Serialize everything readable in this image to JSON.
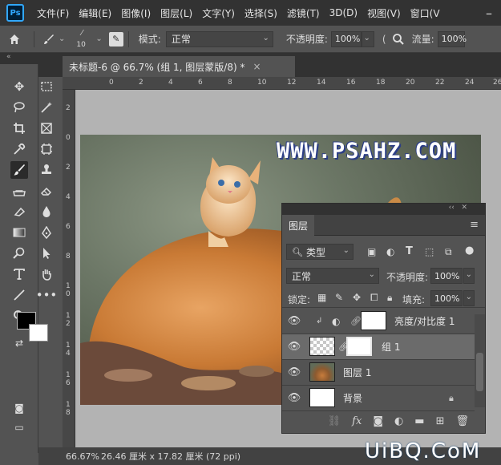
{
  "app": {
    "logo": "Ps"
  },
  "menu": [
    "文件(F)",
    "编辑(E)",
    "图像(I)",
    "图层(L)",
    "文字(Y)",
    "选择(S)",
    "滤镜(T)",
    "3D(D)",
    "视图(V)",
    "窗口(V"
  ],
  "options": {
    "brush_size": "10",
    "mode_label": "模式:",
    "mode_value": "正常",
    "opacity_label": "不透明度:",
    "opacity_value": "100%",
    "flow_label": "流量:",
    "flow_value": "100%"
  },
  "document": {
    "tab_title": "未标题-6 @ 66.7% (组 1, 图层蒙版/8) *",
    "close": "×",
    "ruler_h": [
      "0",
      "2",
      "4",
      "6",
      "8",
      "10",
      "12",
      "14",
      "16",
      "18",
      "20",
      "22",
      "24",
      "26"
    ],
    "ruler_v": [
      "2",
      "0",
      "2",
      "4",
      "6",
      "8",
      "1 0",
      "1 2",
      "1 4",
      "1 6",
      "1 8"
    ],
    "watermark": "WWW.PSAHZ.COM"
  },
  "status": {
    "zoom": "66.67%",
    "info": "26.46 厘米 x 17.82 厘米 (72 ppi)"
  },
  "layers_panel": {
    "tab": "图层",
    "filter_label": "类型",
    "blend_mode": "正常",
    "opacity_label": "不透明度:",
    "opacity_value": "100%",
    "lock_label": "锁定:",
    "fill_label": "填充:",
    "fill_value": "100%",
    "layers": [
      {
        "name": "亮度/对比度 1",
        "kind": "adjustment"
      },
      {
        "name": "组 1",
        "kind": "group-masked",
        "selected": true
      },
      {
        "name": "图层 1",
        "kind": "photo"
      },
      {
        "name": "背景",
        "kind": "background"
      }
    ]
  },
  "site_watermark": "UiBQ.CoM"
}
